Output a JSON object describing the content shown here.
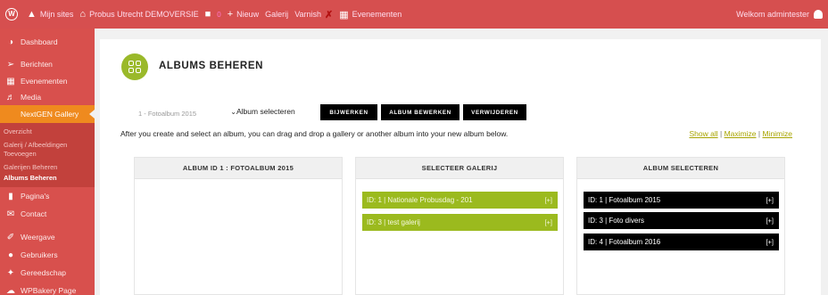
{
  "adminbar": {
    "my_sites": "Mijn sites",
    "site_name": "Probus Utrecht DEMOVERSIE",
    "comments_count": "0",
    "new": "Nieuw",
    "gallery": "Galerij",
    "varnish": "Varnish",
    "events": "Evenementen",
    "welcome": "Welkom admintester"
  },
  "sidebar": {
    "items": [
      {
        "label": "Dashboard",
        "icon": "dashboard-icon"
      },
      {
        "label": "Berichten",
        "icon": "pin-icon"
      },
      {
        "label": "Evenementen",
        "icon": "calendar-icon"
      },
      {
        "label": "Media",
        "icon": "media-icon"
      },
      {
        "label": "NextGEN Gallery",
        "icon": "gallery-icon"
      }
    ],
    "submenu": [
      "Overzicht",
      "Galerij / Afbeeldingen Toevoegen",
      "Galerijen Beheren",
      "Albums Beheren"
    ],
    "items2": [
      {
        "label": "Pagina's",
        "icon": "page-icon"
      },
      {
        "label": "Contact",
        "icon": "mail-icon"
      },
      {
        "label": "Weergave",
        "icon": "brush-icon"
      },
      {
        "label": "Gebruikers",
        "icon": "user-icon"
      },
      {
        "label": "Gereedschap",
        "icon": "wrench-icon"
      },
      {
        "label": "WPBakery Page",
        "icon": "bakery-icon"
      }
    ]
  },
  "main": {
    "title": "ALBUMS BEHEREN",
    "album_select_value": "1 - Fotoalbum 2015",
    "album_select_label": "Album selecteren",
    "buttons": {
      "update": "BIJWERKEN",
      "edit_album": "ALBUM BEWERKEN",
      "delete": "VERWIJDEREN"
    },
    "help_text": "After you create and select an album, you can drag and drop a gallery or another album into your new album below.",
    "links": {
      "show_all": "Show all",
      "maximize": "Maximize",
      "minimize": "Minimize",
      "separator": "|"
    },
    "columns": {
      "album": {
        "title": "ALBUM ID 1 : FOTOALBUM 2015"
      },
      "galleries": {
        "title": "SELECTEER GALERIJ",
        "items": [
          {
            "label": "ID: 1 | Nationale Probusdag - 201",
            "plus": "[+]"
          },
          {
            "label": "ID: 3 | test galerij",
            "plus": "[+]"
          }
        ]
      },
      "albums": {
        "title": "ALBUM SELECTEREN",
        "items": [
          {
            "label": "ID: 1 | Fotoalbum 2015",
            "plus": "[+]"
          },
          {
            "label": "ID: 3 | Foto divers",
            "plus": "[+]"
          },
          {
            "label": "ID: 4 | Fotoalbum 2016",
            "plus": "[+]"
          }
        ]
      }
    }
  },
  "colors": {
    "adminbar": "#d64f4f",
    "sidebar": "#d8504d",
    "accent_green": "#9bba1e",
    "nextgen_orange": "#ef8a1e"
  }
}
